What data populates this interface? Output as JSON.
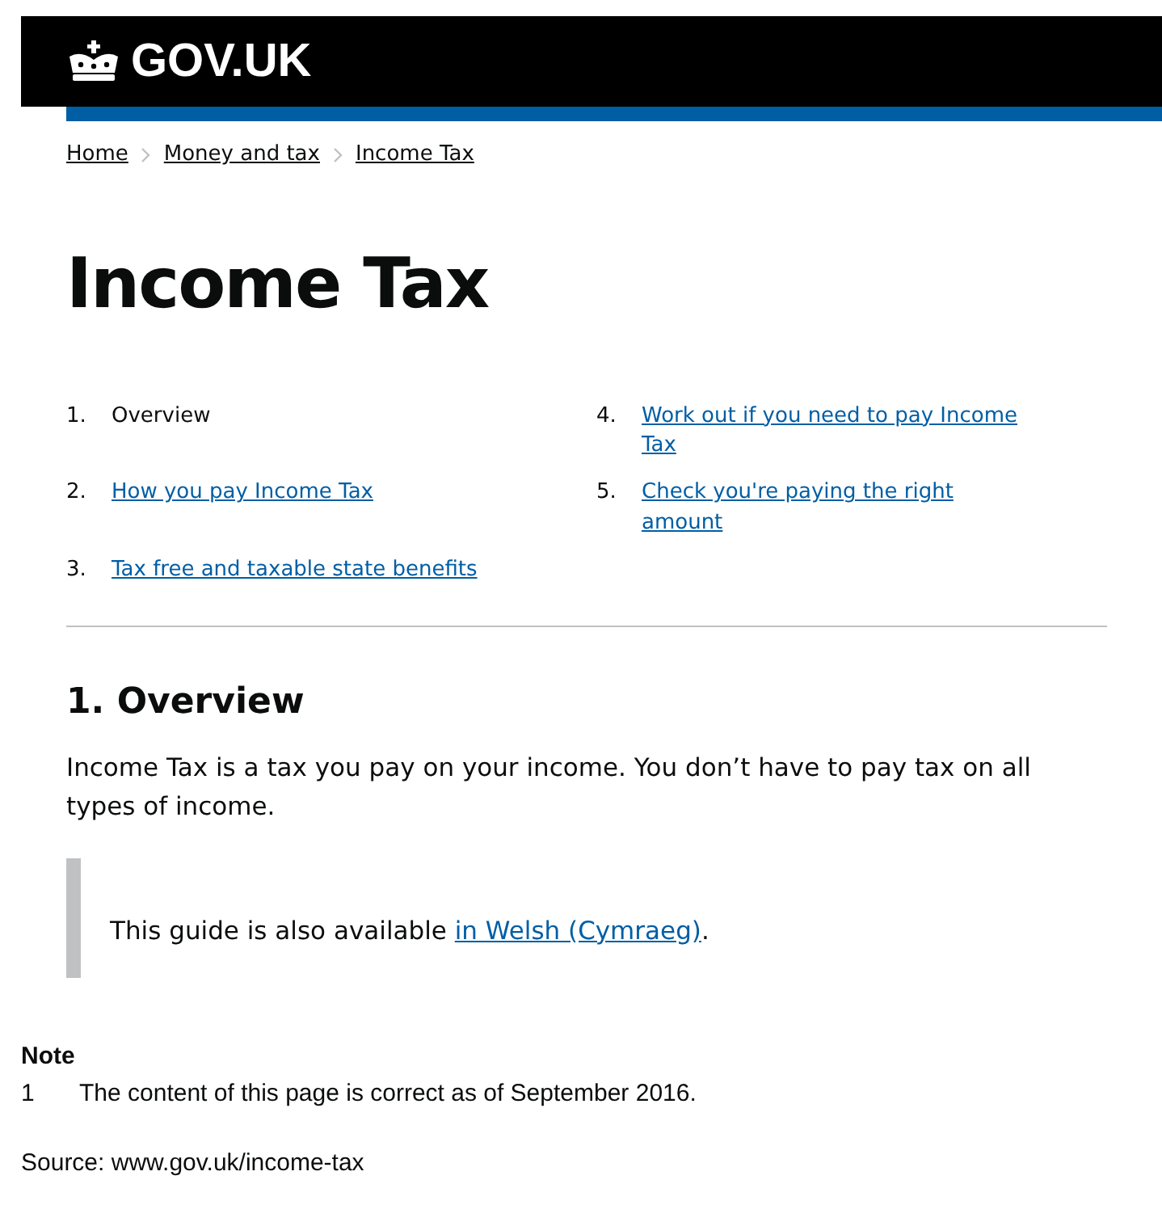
{
  "header": {
    "logo_text": "GOV.UK"
  },
  "breadcrumbs": [
    "Home",
    "Money and tax",
    "Income Tax"
  ],
  "title": "Income Tax",
  "contents": [
    {
      "number": "1.",
      "label": "Overview",
      "selected": true
    },
    {
      "number": "2.",
      "label": "How you pay Income Tax",
      "selected": false
    },
    {
      "number": "3.",
      "label": "Tax free and taxable state benefits",
      "selected": false
    },
    {
      "number": "4.",
      "label": "Work out if you need to pay Income Tax",
      "selected": false
    },
    {
      "number": "5.",
      "label": "Check you're paying the right amount",
      "selected": false
    }
  ],
  "section_heading": "1. Overview",
  "paragraph": "Income Tax is a tax you pay on your income. You don’t have to pay tax on all types of income.",
  "callout": {
    "text": "This guide is also available ",
    "link": "in Welsh (Cymraeg)",
    "after": "."
  },
  "note": {
    "heading": "Note",
    "number": "1",
    "text": "The content of this page is correct as of September 2016."
  },
  "source": "Source: www.gov.uk/income-tax"
}
